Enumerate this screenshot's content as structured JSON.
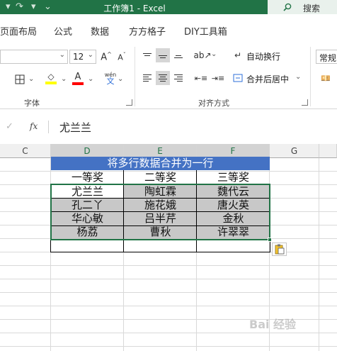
{
  "titlebar": {
    "title": "工作簿1  -  Excel",
    "search_label": "搜索",
    "qa_redo": "↷",
    "qa_customize": "⌄"
  },
  "tabs": [
    "页面布局",
    "公式",
    "数据",
    "方方格子",
    "DIY工具箱"
  ],
  "ribbon": {
    "font_size": "12",
    "grow_font": "A^",
    "shrink_font": "A˅",
    "wrap_text": "自动换行",
    "merge_center": "合并后居中",
    "number_format": "常规",
    "font_group_label": "字体",
    "align_group_label": "对齐方式",
    "font_color_letter": "A",
    "highlight_color": "#ffff00",
    "font_color": "#ff0000",
    "phonetic": "wén"
  },
  "formula_bar": {
    "cancel_icon": "✓",
    "fx_label": "fx",
    "value": "尤兰兰"
  },
  "grid": {
    "columns": [
      "C",
      "D",
      "E",
      "F",
      "G"
    ],
    "selected_columns": [
      "D",
      "E",
      "F"
    ],
    "title_row": "将多行数据合并为一行",
    "header_row": [
      "一等奖",
      "二等奖",
      "三等奖"
    ],
    "rows": [
      [
        "尤兰兰",
        "陶虹霖",
        "魏代云"
      ],
      [
        "孔二丫",
        "施花娥",
        "唐火英"
      ],
      [
        "华心敏",
        "吕半芹",
        "金秋"
      ],
      [
        "杨荔",
        "曹秋",
        "许翠翠"
      ]
    ],
    "selection_fill": "#c8c8c8",
    "accent": "#217346",
    "title_fill": "#4472c4"
  },
  "watermark": "Bai 经验"
}
